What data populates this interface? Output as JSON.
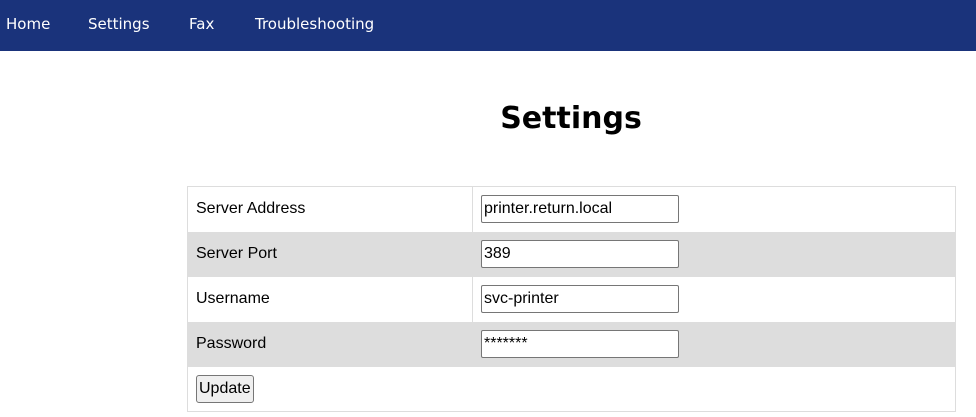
{
  "nav": {
    "items": [
      {
        "label": "Home"
      },
      {
        "label": "Settings"
      },
      {
        "label": "Fax"
      },
      {
        "label": "Troubleshooting"
      }
    ]
  },
  "page": {
    "title": "Settings"
  },
  "form": {
    "rows": [
      {
        "label": "Server Address",
        "value": "printer.return.local"
      },
      {
        "label": "Server Port",
        "value": "389"
      },
      {
        "label": "Username",
        "value": "svc-printer"
      },
      {
        "label": "Password",
        "value": "*******"
      }
    ],
    "submit_label": "Update"
  },
  "colors": {
    "nav_background": "#1a337b",
    "nav_text": "#ffffff",
    "row_alt_background": "#dddddd",
    "table_border": "#dddddd"
  }
}
